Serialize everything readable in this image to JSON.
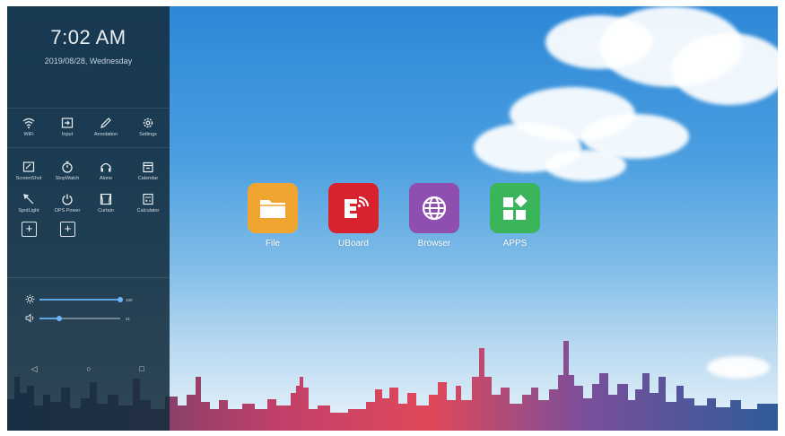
{
  "status": {
    "time": "7:02 AM",
    "date": "2019/08/28, Wednesday"
  },
  "quick_settings": [
    {
      "label": "WiFi",
      "icon": "wifi-icon"
    },
    {
      "label": "Input",
      "icon": "input-icon"
    },
    {
      "label": "Annotation",
      "icon": "pen-icon"
    },
    {
      "label": "Settings",
      "icon": "gear-icon"
    }
  ],
  "tools": [
    {
      "label": "ScreenShot",
      "icon": "screenshot-icon"
    },
    {
      "label": "StopWatch",
      "icon": "stopwatch-icon"
    },
    {
      "label": "Alone",
      "icon": "headphones-icon"
    },
    {
      "label": "Calendar",
      "icon": "calendar-icon"
    },
    {
      "label": "SpotLight",
      "icon": "spotlight-icon"
    },
    {
      "label": "OPS Power",
      "icon": "power-icon"
    },
    {
      "label": "Curtain",
      "icon": "curtain-icon"
    },
    {
      "label": "Calculator",
      "icon": "calculator-icon"
    }
  ],
  "add_buttons": [
    "+",
    "+"
  ],
  "brightness": {
    "value": 100,
    "label": "100",
    "icon": "sun-icon"
  },
  "volume": {
    "value": 21,
    "label": "21",
    "icon": "speaker-icon"
  },
  "nav": {
    "back": "◁",
    "home": "○",
    "recent": "□"
  },
  "apps": [
    {
      "label": "File",
      "color": "#f0a530",
      "icon": "folder-icon"
    },
    {
      "label": "UBoard",
      "color": "#d8232f",
      "icon": "uboard-icon"
    },
    {
      "label": "Browser",
      "color": "#8e4fb0",
      "icon": "globe-icon"
    },
    {
      "label": "APPS",
      "color": "#3ab55a",
      "icon": "apps-grid-icon"
    }
  ]
}
